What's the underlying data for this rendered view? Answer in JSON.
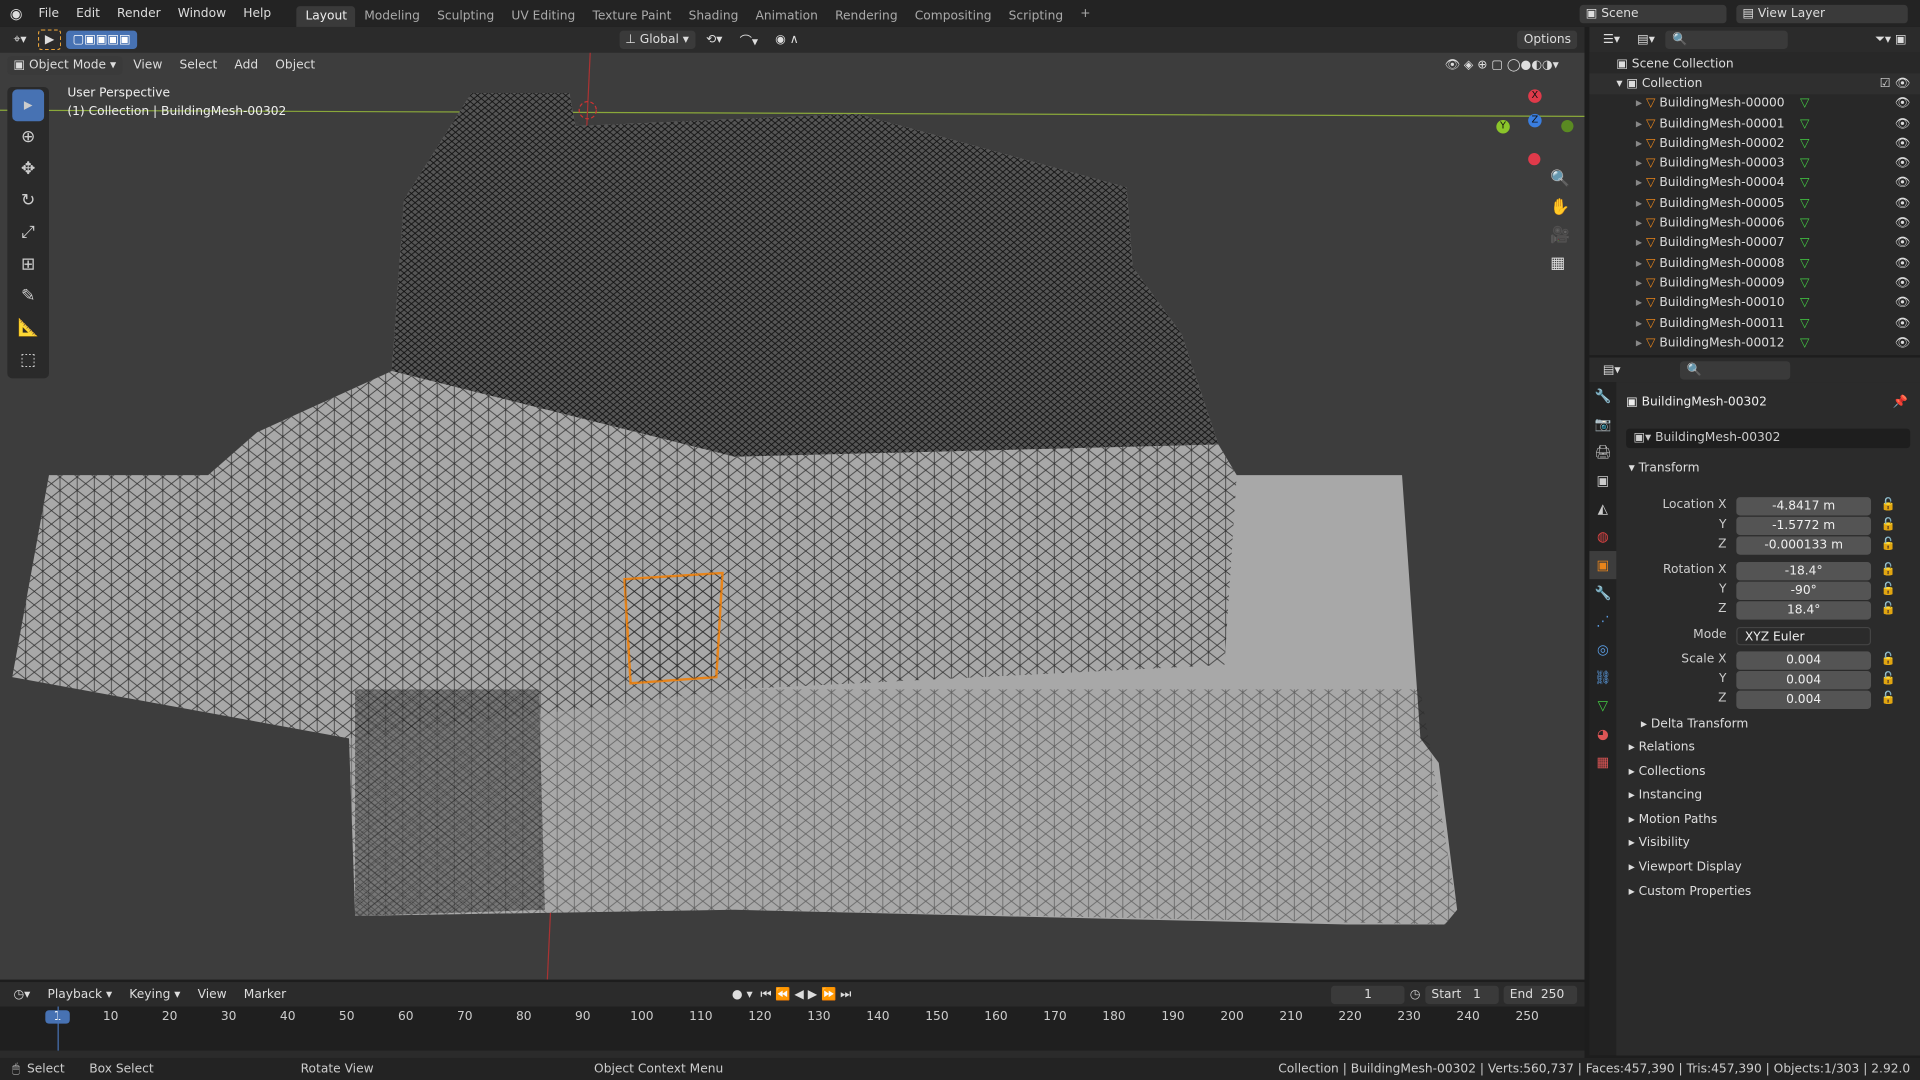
{
  "topbar": {
    "menus": [
      "File",
      "Edit",
      "Render",
      "Window",
      "Help"
    ],
    "workspaces": [
      "Layout",
      "Modeling",
      "Sculpting",
      "UV Editing",
      "Texture Paint",
      "Shading",
      "Animation",
      "Rendering",
      "Compositing",
      "Scripting"
    ],
    "active_workspace": "Layout",
    "add_tab": "+",
    "scene": "Scene",
    "view_layer": "View Layer"
  },
  "header": {
    "mode": "Object Mode",
    "menus": [
      "View",
      "Select",
      "Add",
      "Object"
    ],
    "orientation": "Global",
    "options": "Options"
  },
  "viewport": {
    "perspective": "User Perspective",
    "collection_info": "(1) Collection | BuildingMesh-00302",
    "gizmo": {
      "x": "X",
      "y": "Y",
      "z": "Z"
    },
    "selection_color": "#e8841a",
    "mesh_color": "#a8a8a8"
  },
  "outliner": {
    "root": "Scene Collection",
    "collection": "Collection",
    "items": [
      "BuildingMesh-00000",
      "BuildingMesh-00001",
      "BuildingMesh-00002",
      "BuildingMesh-00003",
      "BuildingMesh-00004",
      "BuildingMesh-00005",
      "BuildingMesh-00006",
      "BuildingMesh-00007",
      "BuildingMesh-00008",
      "BuildingMesh-00009",
      "BuildingMesh-00010",
      "BuildingMesh-00011",
      "BuildingMesh-00012"
    ]
  },
  "properties": {
    "object_name": "BuildingMesh-00302",
    "data_name": "BuildingMesh-00302",
    "transform_label": "Transform",
    "location": {
      "label": "Location X",
      "x": "-4.8417 m",
      "y": "-1.5772 m",
      "z": "-0.000133 m"
    },
    "rotation": {
      "label": "Rotation X",
      "x": "-18.4°",
      "y": "-90°",
      "z": "18.4°"
    },
    "mode": {
      "label": "Mode",
      "value": "XYZ Euler"
    },
    "scale": {
      "label": "Scale X",
      "x": "0.004",
      "y": "0.004",
      "z": "0.004"
    },
    "axis_y": "Y",
    "axis_z": "Z",
    "delta": "Delta Transform",
    "sections": [
      "Relations",
      "Collections",
      "Instancing",
      "Motion Paths",
      "Visibility",
      "Viewport Display",
      "Custom Properties"
    ]
  },
  "timeline": {
    "menus": [
      "Playback",
      "Keying",
      "View",
      "Marker"
    ],
    "current_frame": "1",
    "start_label": "Start",
    "start": "1",
    "end_label": "End",
    "end": "250",
    "ticks": [
      "1",
      "10",
      "20",
      "30",
      "40",
      "50",
      "60",
      "70",
      "80",
      "90",
      "100",
      "110",
      "120",
      "130",
      "140",
      "150",
      "160",
      "170",
      "180",
      "190",
      "200",
      "210",
      "220",
      "230",
      "240",
      "250"
    ]
  },
  "status": {
    "select": "Select",
    "box_select": "Box Select",
    "rotate": "Rotate View",
    "context": "Object Context Menu",
    "info": "Collection | BuildingMesh-00302 | Verts:560,737 | Faces:457,390 | Tris:457,390 | Objects:1/303 | 2.92.0"
  }
}
